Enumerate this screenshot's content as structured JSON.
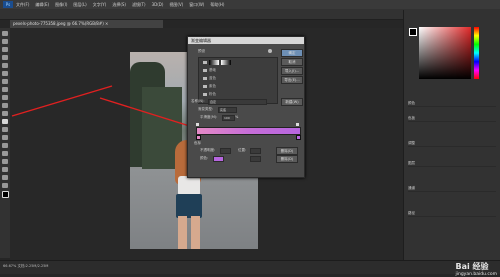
{
  "menubar": {
    "logo": "Ps",
    "items": [
      "文件(F)",
      "编辑(E)",
      "图像(I)",
      "图层(L)",
      "文字(Y)",
      "选择(S)",
      "滤镜(T)",
      "3D(D)",
      "视图(V)",
      "窗口(W)",
      "帮助(H)"
    ]
  },
  "document": {
    "tab_title": "pexels-photo-775358.jpeg @ 66.7%(RGB/8#) ×"
  },
  "dialog": {
    "title": "渐变编辑器",
    "presets_label": "预设",
    "presets": [
      "基础",
      "蓝色",
      "紫色",
      "粉色"
    ],
    "buttons": {
      "ok": "确定",
      "cancel": "取消",
      "import": "导入(I)...",
      "export": "导出(E)..."
    },
    "name_label": "名称(N):",
    "name_value": "自定",
    "new_button": "新建(W)",
    "type_label": "渐变类型:",
    "type_value": "实底",
    "smooth_label": "平滑度(M):",
    "smooth_value": "100",
    "smooth_unit": "%",
    "stops_label": "色标",
    "opacity_label": "不透明度:",
    "location_label": "位置:",
    "delete_label": "删除(D)",
    "color_label": "颜色:",
    "gradient_colors": [
      "#e58ac6",
      "#c76ed8",
      "#b766e0"
    ]
  },
  "right_panel": {
    "rows": [
      "颜色",
      "色板",
      "调整",
      "图层",
      "通道",
      "路径"
    ]
  },
  "status": {
    "text": "66.67%    文档:2.25M/2.25M"
  },
  "watermark": {
    "brand": "Bai 经验",
    "url": "jingyan.baidu.com"
  }
}
